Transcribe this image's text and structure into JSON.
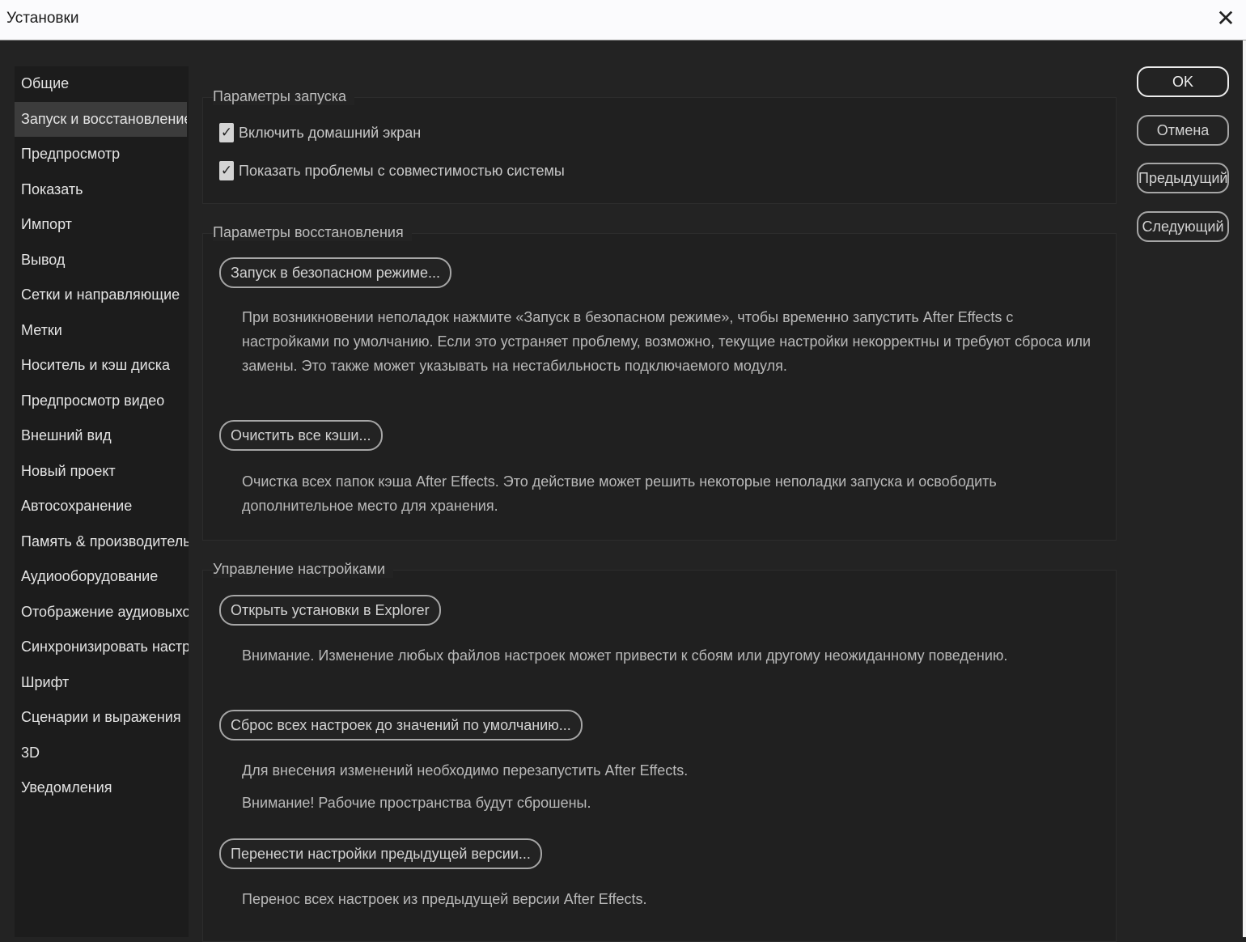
{
  "window": {
    "title": "Установки",
    "close_icon": "close-icon"
  },
  "sidebar": {
    "items": [
      "Общие",
      "Запуск и восстановление",
      "Предпросмотр",
      "Показать",
      "Импорт",
      "Вывод",
      "Сетки и направляющие",
      "Метки",
      "Носитель и кэш диска",
      "Предпросмотр видео",
      "Внешний вид",
      "Новый проект",
      "Автосохранение",
      "Память & производительность",
      "Аудиооборудование",
      "Отображение аудиовыхода",
      "Синхронизировать настройки",
      "Шрифт",
      "Сценарии и выражения",
      "3D",
      "Уведомления"
    ],
    "active_index": 1
  },
  "launch": {
    "legend": "Параметры запуска",
    "enable_home": {
      "label": "Включить домашний экран",
      "checked": true
    },
    "show_compat": {
      "label": "Показать проблемы с совместимостью системы",
      "checked": true
    }
  },
  "recovery": {
    "legend": "Параметры восстановления",
    "safe_mode_button": "Запуск в безопасном режиме...",
    "safe_mode_desc": "При возникновении неполадок нажмите «Запуск в безопасном режиме», чтобы временно запустить After Effects с настройками по умолчанию. Если это устраняет проблему, возможно, текущие настройки некорректны и требуют сброса или замены. Это также может указывать на нестабильность подключаемого модуля.",
    "clear_cache_button": "Очистить все кэши...",
    "clear_cache_desc": "Очистка всех папок кэша After Effects. Это действие может решить некоторые неполадки запуска и освободить дополнительное место для хранения."
  },
  "manage": {
    "legend": "Управление настройками",
    "open_explorer_button": "Открыть установки в Explorer",
    "open_explorer_desc": "Внимание. Изменение любых файлов настроек может привести к сбоям или другому неожиданному поведению.",
    "reset_button": "Сброс всех настроек до значений по умолчанию...",
    "reset_desc_1": "Для внесения изменений необходимо перезапустить After Effects.",
    "reset_desc_2": "Внимание! Рабочие пространства будут сброшены.",
    "migrate_button": "Перенести настройки предыдущей версии...",
    "migrate_desc": "Перенос всех настроек из предыдущей версии After Effects."
  },
  "actions": {
    "ok": "OK",
    "cancel": "Отмена",
    "previous": "Предыдущий",
    "next": "Следующий"
  }
}
